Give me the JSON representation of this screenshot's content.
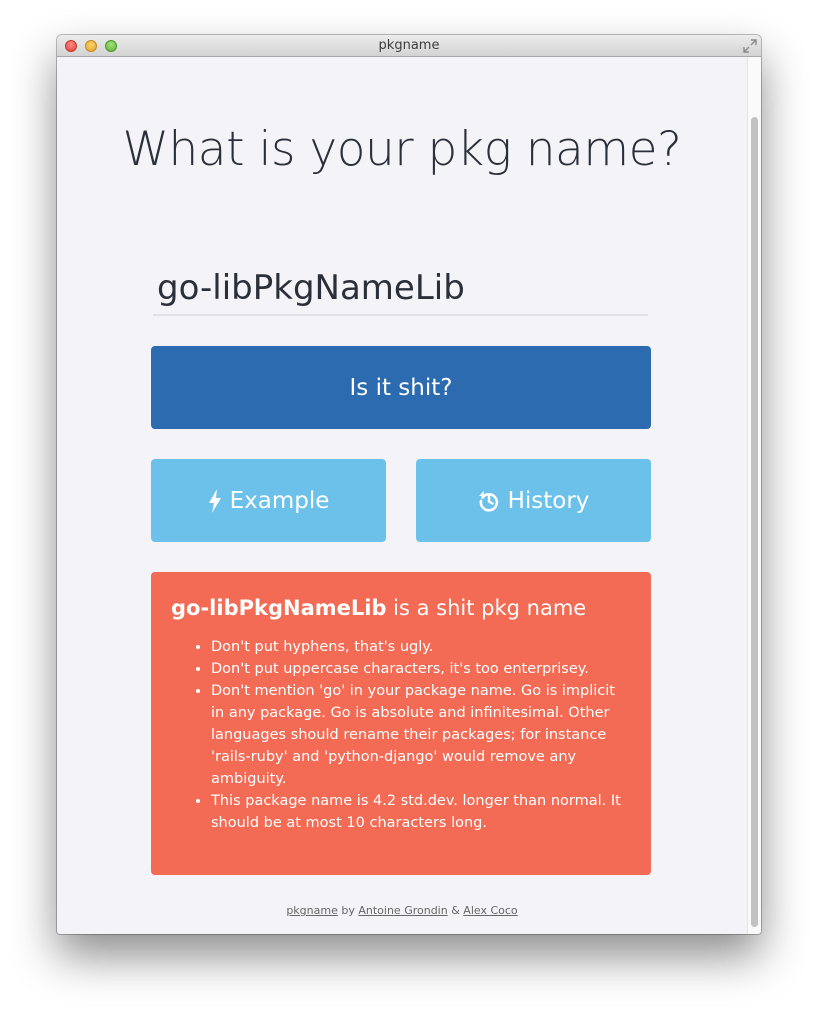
{
  "window": {
    "title": "pkgname"
  },
  "header": {
    "title": "What is your pkg name?"
  },
  "input": {
    "value": "go-libPkgNameLib"
  },
  "buttons": {
    "check_label": "Is it shit?",
    "example_label": "Example",
    "history_label": "History"
  },
  "result": {
    "pkg_name": "go-libPkgNameLib",
    "verdict": " is a shit pkg name",
    "reasons": [
      "Don't put hyphens, that's ugly.",
      "Don't put uppercase characters, it's too enterprisey.",
      "Don't mention 'go' in your package name. Go is implicit in any package. Go is absolute and infinitesimal. Other languages should rename their packages; for instance 'rails-ruby' and 'python-django' would remove any ambiguity.",
      "This package name is 4.2 std.dev. longer than normal. It should be at most 10 characters long."
    ],
    "color": "#f46b55"
  },
  "footer": {
    "link_pkgname": "pkgname",
    "by": " by ",
    "author1": "Antoine Grondin",
    "amp": " & ",
    "author2": "Alex Coco"
  },
  "colors": {
    "primary_button": "#2d6bb0",
    "secondary_button": "#6cc1ea",
    "background": "#f4f4f8"
  },
  "icons": {
    "example": "bolt-icon",
    "history": "history-icon"
  }
}
